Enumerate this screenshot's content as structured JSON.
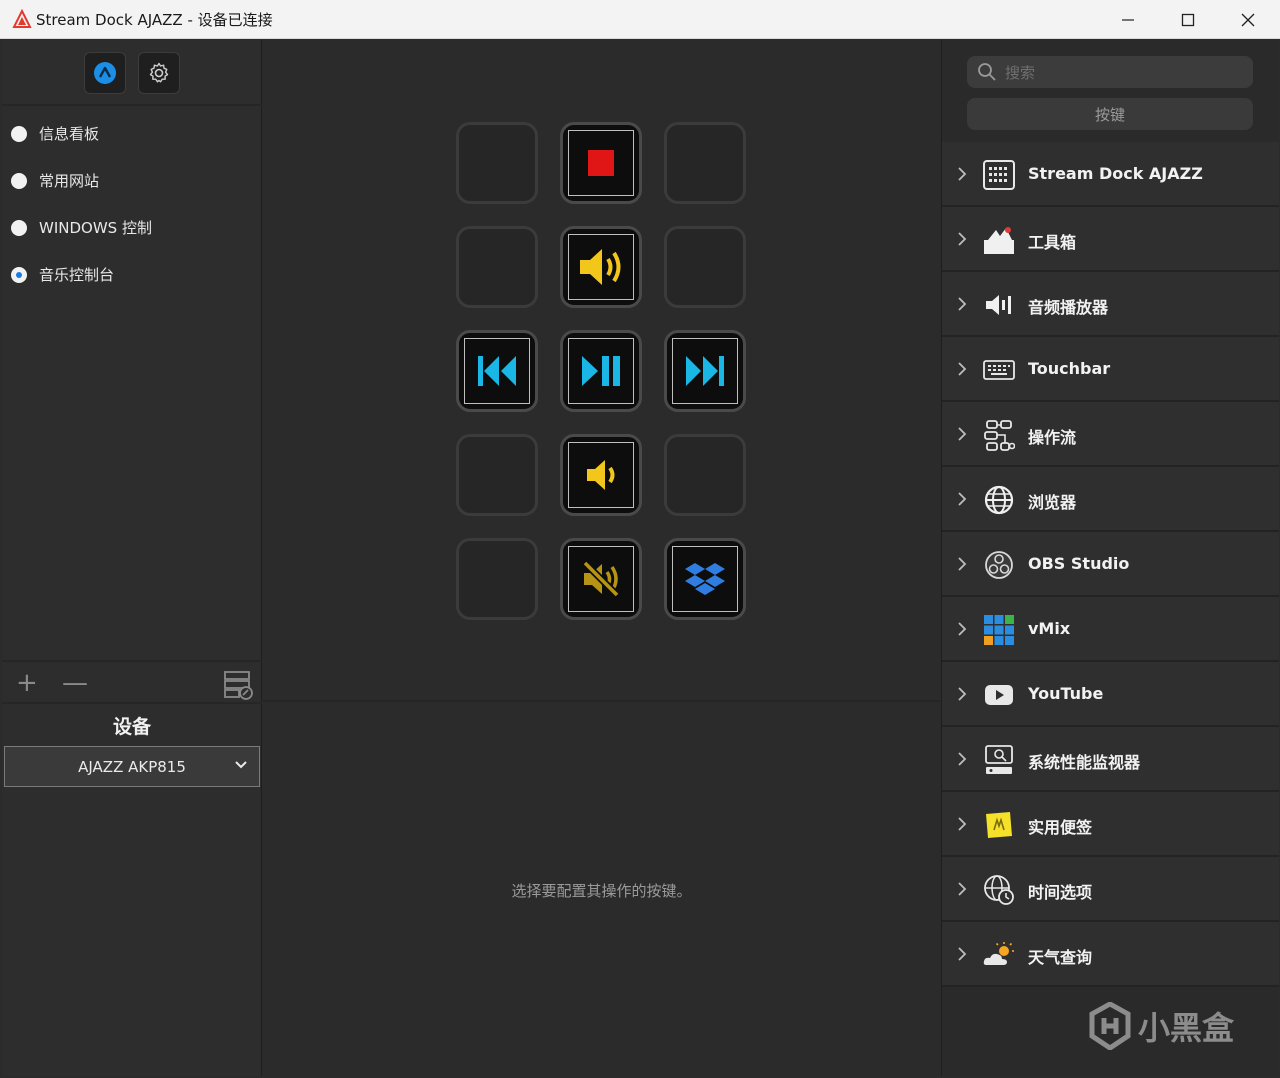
{
  "window": {
    "title": "Stream Dock AJAZZ - 设备已连接",
    "minimize": "—",
    "maximize": "☐",
    "close": "✕"
  },
  "left": {
    "profiles": [
      {
        "label": "信息看板",
        "selected": false
      },
      {
        "label": "常用网站",
        "selected": false
      },
      {
        "label": "WINDOWS 控制",
        "selected": false
      },
      {
        "label": "音乐控制台",
        "selected": true
      }
    ],
    "add_label": "+",
    "remove_label": "—",
    "device_title": "设备",
    "device_value": "AJAZZ AKP815"
  },
  "center": {
    "hint": "选择要配置其操作的按键。",
    "keys": [
      {
        "slot": "1-1",
        "icon": "empty"
      },
      {
        "slot": "1-2",
        "icon": "stop-icon"
      },
      {
        "slot": "1-3",
        "icon": "empty"
      },
      {
        "slot": "2-1",
        "icon": "empty"
      },
      {
        "slot": "2-2",
        "icon": "volume-up-icon"
      },
      {
        "slot": "2-3",
        "icon": "empty"
      },
      {
        "slot": "3-1",
        "icon": "previous-track-icon"
      },
      {
        "slot": "3-2",
        "icon": "play-pause-icon"
      },
      {
        "slot": "3-3",
        "icon": "next-track-icon"
      },
      {
        "slot": "4-1",
        "icon": "empty"
      },
      {
        "slot": "4-2",
        "icon": "volume-down-icon"
      },
      {
        "slot": "4-3",
        "icon": "empty"
      },
      {
        "slot": "5-1",
        "icon": "empty"
      },
      {
        "slot": "5-2",
        "icon": "mute-icon"
      },
      {
        "slot": "5-3",
        "icon": "dropbox-icon"
      }
    ]
  },
  "right": {
    "search_placeholder": "搜索",
    "category_button": "按键",
    "plugins": [
      {
        "label": "Stream Dock AJAZZ",
        "icon": "keypad-grid-icon"
      },
      {
        "label": "工具箱",
        "icon": "toolbox-icon"
      },
      {
        "label": "音频播放器",
        "icon": "audio-player-icon"
      },
      {
        "label": "Touchbar",
        "icon": "keyboard-icon"
      },
      {
        "label": "操作流",
        "icon": "workflow-icon"
      },
      {
        "label": "浏览器",
        "icon": "globe-icon"
      },
      {
        "label": "OBS Studio",
        "icon": "obs-icon"
      },
      {
        "label": "vMix",
        "icon": "vmix-icon"
      },
      {
        "label": "YouTube",
        "icon": "youtube-icon"
      },
      {
        "label": "系统性能监视器",
        "icon": "system-monitor-icon"
      },
      {
        "label": "实用便签",
        "icon": "sticky-note-icon"
      },
      {
        "label": "时间选项",
        "icon": "world-clock-icon"
      },
      {
        "label": "天气查询",
        "icon": "weather-icon"
      }
    ]
  },
  "watermark": "小黑盒",
  "colors": {
    "accent_blue": "#1b7be6",
    "media_cyan": "#19b6e6",
    "volume_yellow": "#f2c61a",
    "stop_red": "#e01515"
  }
}
